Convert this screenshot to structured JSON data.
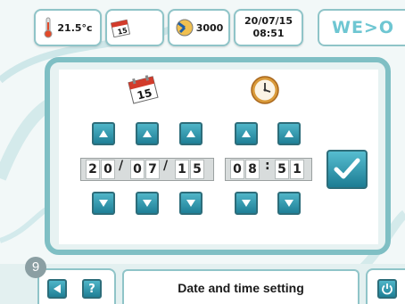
{
  "header": {
    "temperature": "21.5°c",
    "calendar_icon_day": "15",
    "power_value": "3000",
    "date": "20/07/15",
    "time": "08:51",
    "logo": "WE>O"
  },
  "panel": {
    "calendar_icon_day": "15",
    "date_digits": [
      "2",
      "0",
      "0",
      "7",
      "1",
      "5"
    ],
    "time_digits": [
      "0",
      "8",
      "5",
      "1"
    ],
    "date_separator": "/",
    "time_separator": ":"
  },
  "footer": {
    "page_number": "9",
    "help_label": "?",
    "title": "Date and time setting"
  },
  "colors": {
    "accent": "#1f7f96",
    "frame": "#7fbfc4",
    "logo": "#6ec6d2"
  }
}
